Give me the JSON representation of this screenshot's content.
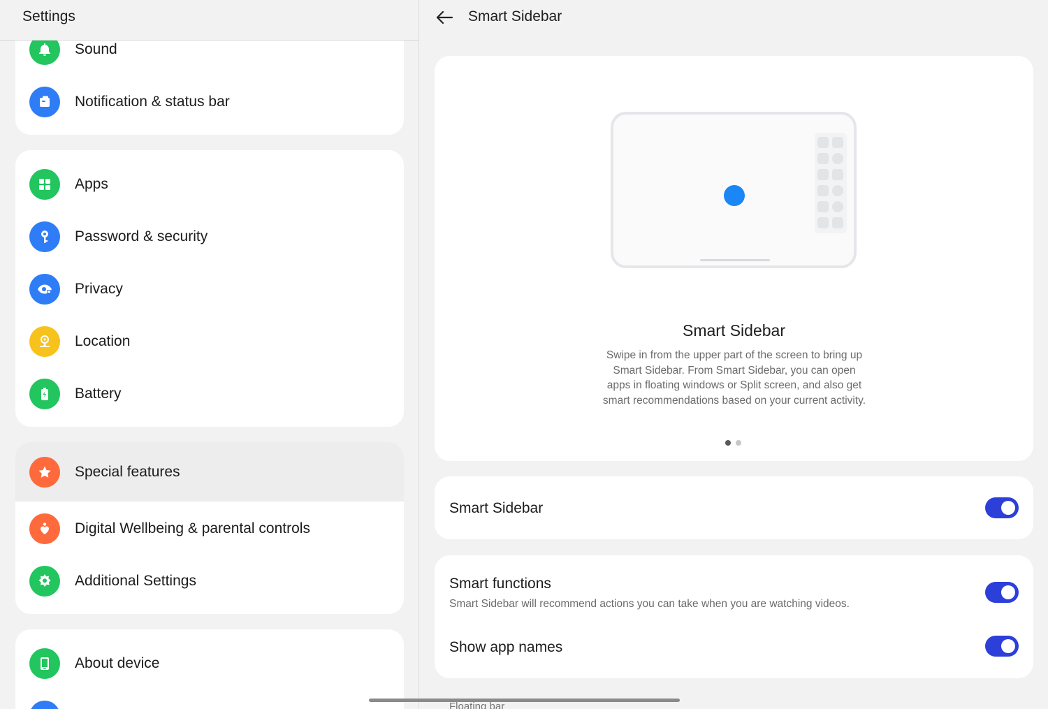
{
  "left": {
    "title": "Settings",
    "group1": [
      {
        "label": "Sound",
        "icon": "bell-icon"
      },
      {
        "label": "Notification & status bar",
        "icon": "notification-icon"
      }
    ],
    "group2": [
      {
        "label": "Apps",
        "icon": "apps-grid-icon"
      },
      {
        "label": "Password & security",
        "icon": "key-icon"
      },
      {
        "label": "Privacy",
        "icon": "eye-lock-icon"
      },
      {
        "label": "Location",
        "icon": "location-pin-icon"
      },
      {
        "label": "Battery",
        "icon": "battery-icon"
      }
    ],
    "group3": [
      {
        "label": "Special features",
        "icon": "star-icon"
      },
      {
        "label": "Digital Wellbeing & parental controls",
        "icon": "wellbeing-heart-icon"
      },
      {
        "label": "Additional Settings",
        "icon": "gear-icon"
      }
    ],
    "group4": [
      {
        "label": "About device",
        "icon": "device-icon"
      }
    ]
  },
  "right": {
    "title": "Smart Sidebar",
    "feature": {
      "title": "Smart Sidebar",
      "description": "Swipe in from the upper part of the screen to bring up Smart Sidebar. From Smart Sidebar, you can open apps in floating windows or Split screen, and also get smart recommendations based on your current activity.",
      "pages": 2,
      "current_page": 1
    },
    "settings": {
      "smart_sidebar": {
        "label": "Smart Sidebar",
        "enabled": true
      },
      "smart_functions": {
        "label": "Smart functions",
        "subtitle": "Smart Sidebar will recommend actions you can take when you are watching videos.",
        "enabled": true
      },
      "show_app_names": {
        "label": "Show app names",
        "enabled": true
      }
    },
    "peek_label": "Floating bar"
  },
  "colors": {
    "accent_toggle": "#2c3fd9",
    "icon_green": "#22c55e",
    "icon_blue": "#2f7df6",
    "icon_yellow": "#f7c21c",
    "icon_orange": "#ff6a3c"
  }
}
